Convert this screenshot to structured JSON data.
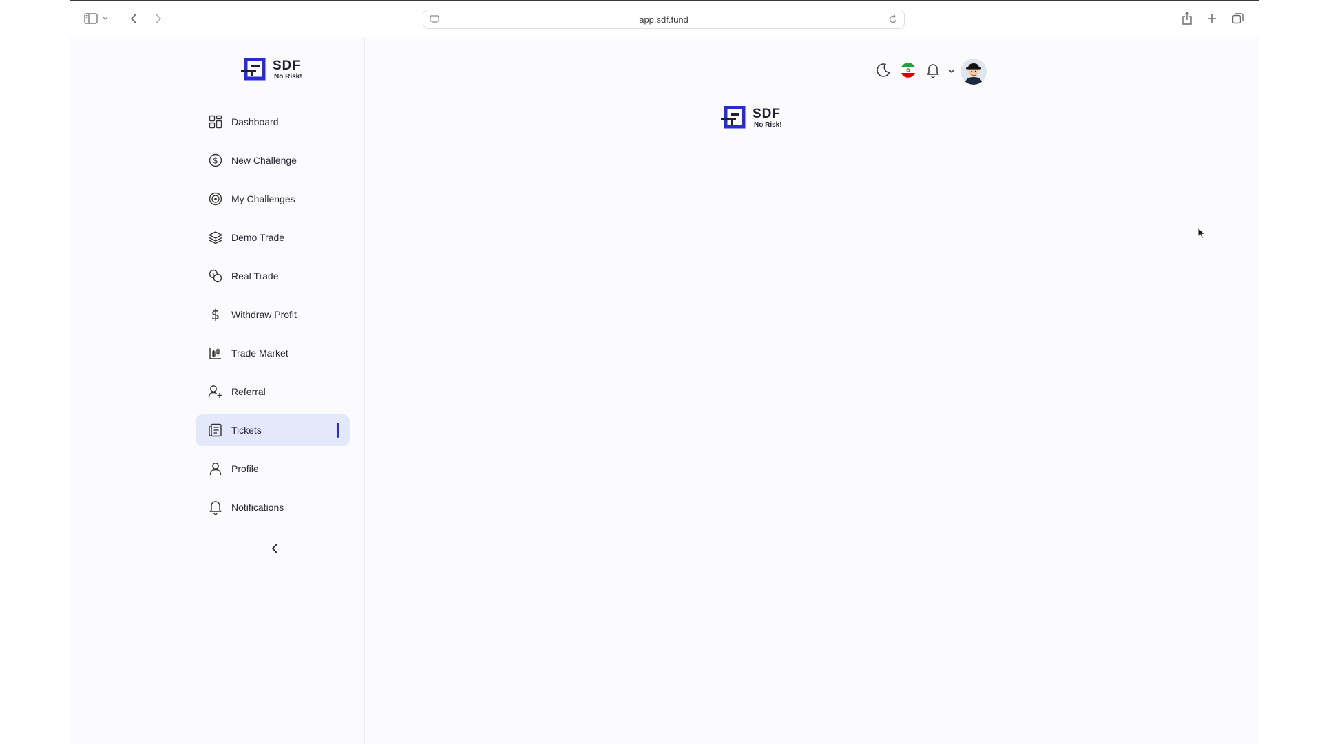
{
  "browser": {
    "url": "app.sdf.fund"
  },
  "brand": {
    "name": "SDF",
    "tagline": "No Risk!",
    "color_primary": "#2b2bd6",
    "color_dark": "#1f1f33"
  },
  "sidebar": {
    "items": [
      {
        "label": "Dashboard",
        "icon": "grid-icon"
      },
      {
        "label": "New Challenge",
        "icon": "dollar-circle-icon"
      },
      {
        "label": "My Challenges",
        "icon": "target-icon"
      },
      {
        "label": "Demo Trade",
        "icon": "layers-icon"
      },
      {
        "label": "Real Trade",
        "icon": "coins-icon"
      },
      {
        "label": "Withdraw Profit",
        "icon": "dollar-icon"
      },
      {
        "label": "Trade Market",
        "icon": "candlestick-icon"
      },
      {
        "label": "Referral",
        "icon": "user-plus-icon"
      },
      {
        "label": "Tickets",
        "icon": "receipt-icon",
        "active": true
      },
      {
        "label": "Profile",
        "icon": "user-icon"
      },
      {
        "label": "Notifications",
        "icon": "bell-icon"
      }
    ],
    "active_color": "#e4e8fb"
  },
  "header": {
    "icons": [
      "moon-icon",
      "iran-flag-icon",
      "bell-icon",
      "chevron-down-icon",
      "avatar"
    ]
  }
}
